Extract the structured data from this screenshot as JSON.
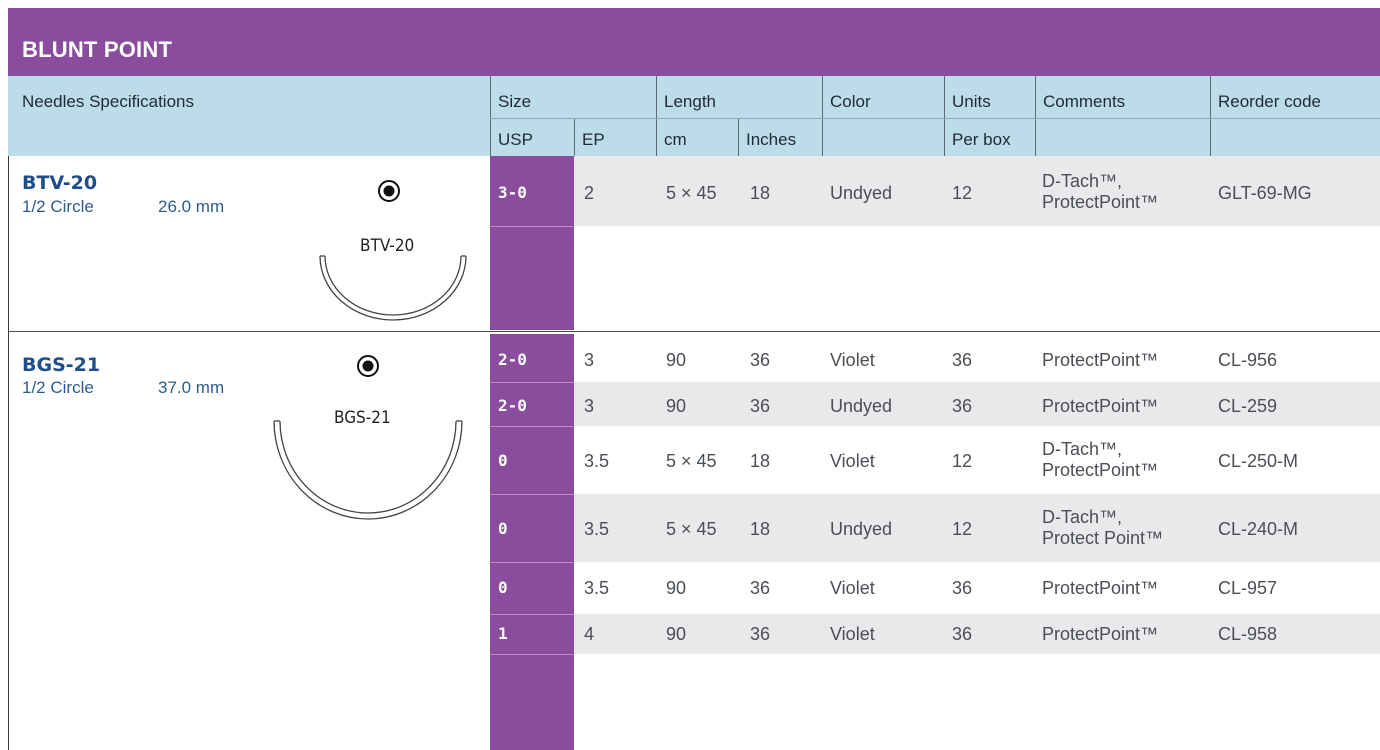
{
  "title": "BLUNT POINT",
  "header": {
    "needles": "Needles Specifications",
    "size": "Size",
    "usp": "USP",
    "ep": "EP",
    "length": "Length",
    "cm": "cm",
    "inches": "Inches",
    "color": "Color",
    "units": "Units",
    "per_box": "Per box",
    "comments": "Comments",
    "reorder": "Reorder code"
  },
  "colors": {
    "brand_purple": "#8a4d9e",
    "header_blue": "#bcdcea",
    "needle_blue": "#1e4e8a",
    "row_gray": "#e9e9eb"
  },
  "needles": [
    {
      "name": "BTV-20",
      "shape": "1/2 Circle",
      "size": "26.0 mm",
      "tag": "BTV-20",
      "icon": "cross-section-icon",
      "rows": [
        {
          "usp": "3-0",
          "ep": "2",
          "cm": "5 × 45",
          "inches": "18",
          "color": "Undyed",
          "units": "12",
          "comments": [
            "D-Tach™,",
            "ProtectPoint™"
          ],
          "code": "GLT-69-MG"
        }
      ]
    },
    {
      "name": "BGS-21",
      "shape": "1/2 Circle",
      "size": "37.0 mm",
      "tag": "BGS-21",
      "icon": "cross-section-icon",
      "rows": [
        {
          "usp": "2-0",
          "ep": "3",
          "cm": "90",
          "inches": "36",
          "color": "Violet",
          "units": "36",
          "comments": [
            "ProtectPoint™"
          ],
          "code": "CL-956"
        },
        {
          "usp": "2-0",
          "ep": "3",
          "cm": "90",
          "inches": "36",
          "color": "Undyed",
          "units": "36",
          "comments": [
            "ProtectPoint™"
          ],
          "code": "CL-259"
        },
        {
          "usp": "0",
          "ep": "3.5",
          "cm": "5 × 45",
          "inches": "18",
          "color": "Violet",
          "units": "12",
          "comments": [
            "D-Tach™,",
            "ProtectPoint™"
          ],
          "code": "CL-250-M"
        },
        {
          "usp": "0",
          "ep": "3.5",
          "cm": "5 × 45",
          "inches": "18",
          "color": "Undyed",
          "units": "12",
          "comments": [
            "D-Tach™,",
            "Protect Point™"
          ],
          "code": "CL-240-M"
        },
        {
          "usp": "0",
          "ep": "3.5",
          "cm": "90",
          "inches": "36",
          "color": "Violet",
          "units": "36",
          "comments": [
            "ProtectPoint™"
          ],
          "code": "CL-957"
        },
        {
          "usp": "1",
          "ep": "4",
          "cm": "90",
          "inches": "36",
          "color": "Violet",
          "units": "36",
          "comments": [
            "ProtectPoint™"
          ],
          "code": "CL-958"
        }
      ]
    }
  ]
}
